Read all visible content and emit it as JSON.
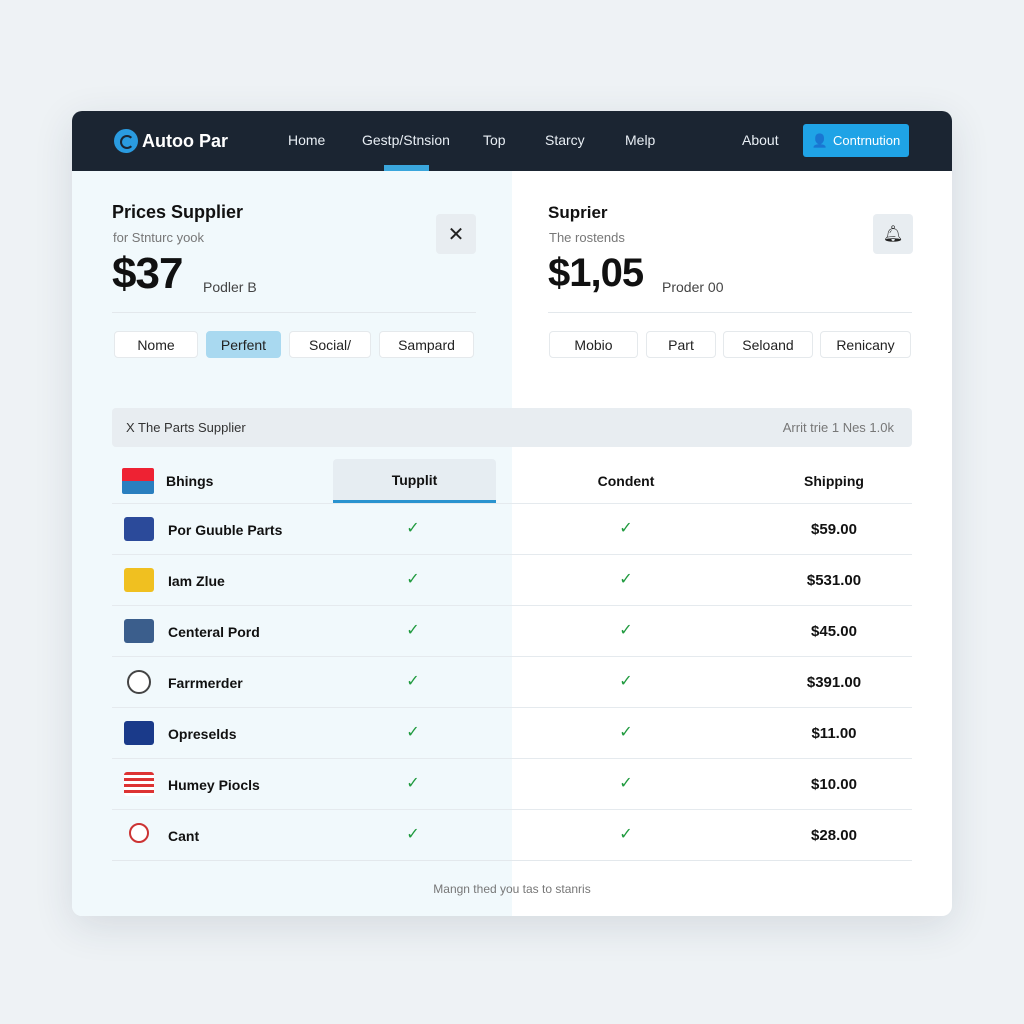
{
  "nav": {
    "brand": "Autoo Par",
    "links": [
      "Home",
      "Gestp/Stnsion",
      "Top",
      "Starcy",
      "Melp",
      "About"
    ],
    "active_index": 1,
    "button_label": "Contrnution",
    "accent": "#1fa3e6"
  },
  "left": {
    "title": "Prices Supplier",
    "subtitle": "for Stnturc yook",
    "price": "$37",
    "price_label": "Podler B",
    "close_icon": "close-icon",
    "filters": [
      "Nome",
      "Perfent",
      "Social/",
      "Sampard"
    ],
    "active_filter": 1
  },
  "right": {
    "title": "Suprier",
    "subtitle": "The rostends",
    "price": "$1,05",
    "price_label": "Proder 00",
    "bell_icon": "bell-icon",
    "filters": [
      "Mobio",
      "Part",
      "Seloand",
      "Renicany"
    ]
  },
  "bar": {
    "left": "X The Parts Supplier",
    "right": "Arrit trie 1 Nes 1.0k"
  },
  "table": {
    "headers": [
      "Bhings",
      "Tupplit",
      "Condent",
      "Shipping"
    ],
    "rows": [
      {
        "name": "Por Guuble Parts",
        "supplit": "✓",
        "condent": "✓",
        "shipping": "$59.00"
      },
      {
        "name": "Iam Zlue",
        "supplit": "✓",
        "condent": "✓",
        "shipping": "$531.00"
      },
      {
        "name": "Centeral Pord",
        "supplit": "✓",
        "condent": "✓",
        "shipping": "$45.00"
      },
      {
        "name": "Farrmerder",
        "supplit": "✓",
        "condent": "✓",
        "shipping": "$391.00"
      },
      {
        "name": "Opreselds",
        "supplit": "✓",
        "condent": "✓",
        "shipping": "$11.00"
      },
      {
        "name": "Humey Piocls",
        "supplit": "✓",
        "condent": "✓",
        "shipping": "$10.00"
      },
      {
        "name": "Cant",
        "supplit": "✓",
        "condent": "✓",
        "shipping": "$28.00"
      }
    ]
  },
  "footer": "Mangn thed you tas to stanris"
}
